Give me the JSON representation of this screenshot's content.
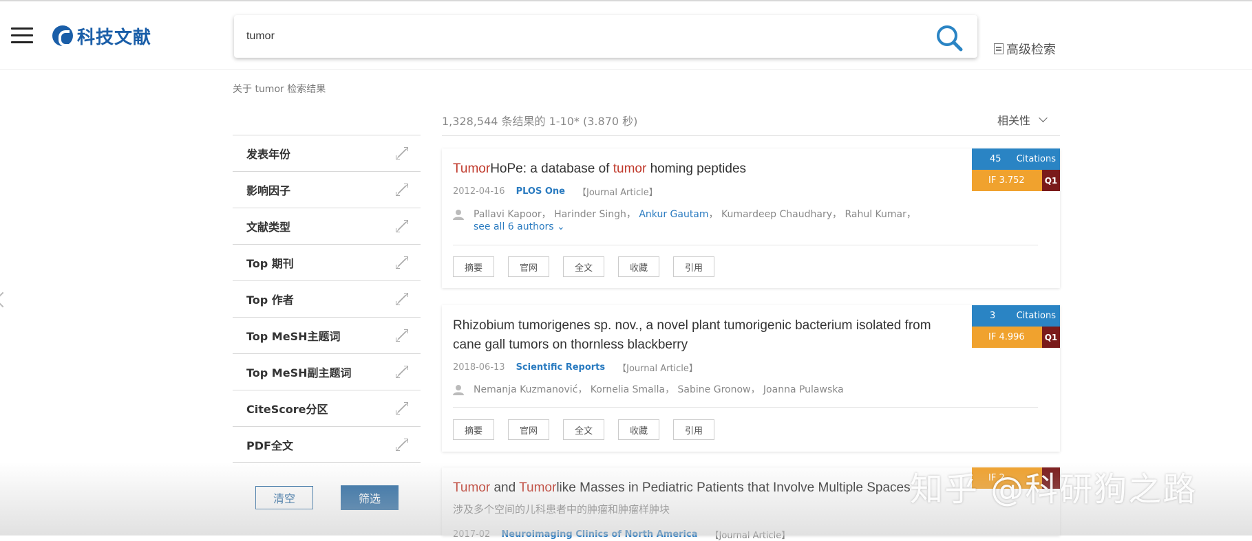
{
  "header": {
    "brand": "科技文献",
    "search_value": "tumor",
    "advanced_search": "高级检索"
  },
  "query_label": "关于 tumor 检索结果",
  "results": {
    "count_text": "1,328,544 条结果的 1-10* (3.870 秒)",
    "sort_label": "相关性"
  },
  "filters": {
    "items": [
      {
        "label": "发表年份"
      },
      {
        "label": "影响因子"
      },
      {
        "label": "文献类型"
      },
      {
        "label": "Top 期刊"
      },
      {
        "label": "Top 作者"
      },
      {
        "label": "Top MeSH主题词"
      },
      {
        "label": "Top MeSH副主题词"
      },
      {
        "label": "CiteScore分区"
      },
      {
        "label": "PDF全文"
      }
    ],
    "clear_label": "清空",
    "apply_label": "筛选"
  },
  "action_labels": [
    "摘要",
    "官网",
    "全文",
    "收藏",
    "引用"
  ],
  "cards": [
    {
      "title_parts": [
        {
          "text": "Tumor",
          "hl": true
        },
        {
          "text": "HoPe: a database of ",
          "hl": false
        },
        {
          "text": "tumor",
          "hl": true
        },
        {
          "text": " homing peptides",
          "hl": false
        }
      ],
      "date": "2012-04-16",
      "journal": "PLOS One",
      "article_type": "【Journal Article】",
      "authors_plain_1": "Pallavi Kapoor， Harinder Singh， ",
      "author_link": "Ankur Gautam",
      "authors_plain_2": "， Kumardeep Chaudhary， Rahul Kumar， ",
      "see_all": "see all 6 authors",
      "citations": "45",
      "citations_label": "Citations",
      "if_value": "IF 3.752",
      "quartile": "Q1"
    },
    {
      "title": "Rhizobium tumorigenes sp. nov., a novel plant tumorigenic bacterium isolated from cane gall tumors on thornless blackberry",
      "date": "2018-06-13",
      "journal": "Scientific Reports",
      "article_type": "【Journal Article】",
      "authors": "Nemanja Kuzmanović， Kornelia Smalla， Sabine Gronow， Joanna Pulawska",
      "citations": "3",
      "citations_label": "Citations",
      "if_value": "IF 4.996",
      "quartile": "Q1"
    },
    {
      "title_parts": [
        {
          "text": "Tumor",
          "hl": true
        },
        {
          "text": " and ",
          "hl": false
        },
        {
          "text": "Tumor",
          "hl": true
        },
        {
          "text": "like Masses in Pediatric Patients that Involve Multiple Spaces",
          "hl": false
        }
      ],
      "subtitle": "涉及多个空间的儿科患者中的肿瘤和肿瘤样肿块",
      "date": "2017-02",
      "journal": "Neuroimaging Clinics of North America",
      "article_type": "【Journal Article】",
      "if_partial": "IF 2"
    }
  ],
  "watermark": "知乎 @科研狗之路",
  "colors": {
    "brand": "#1a5ea8",
    "highlight": "#c0392b",
    "citations_bg": "#2a84c4",
    "if_bg": "#f0a22e",
    "quartile_bg": "#7a1a1a"
  }
}
